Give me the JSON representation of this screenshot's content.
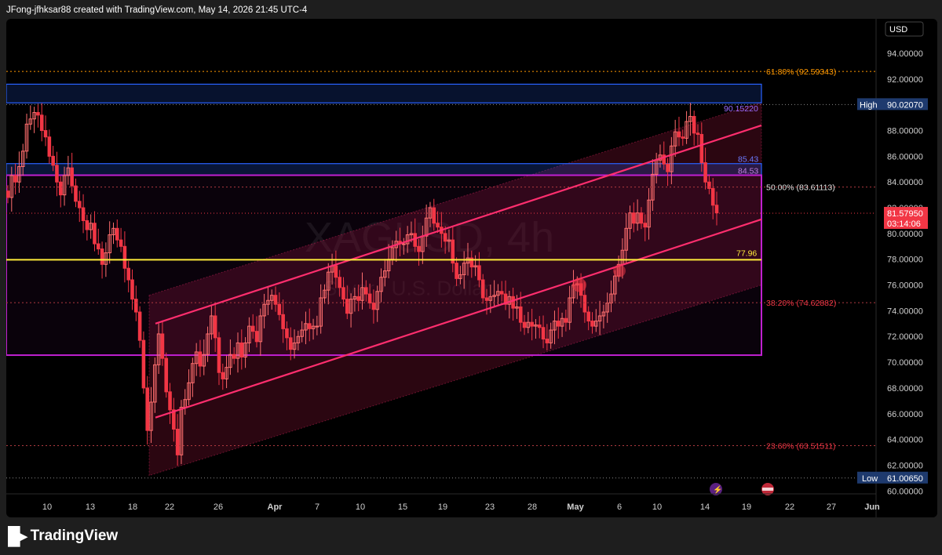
{
  "header": {
    "text": "JFong-jfhksar88 created with TradingView.com, May 14, 2026 21:45 UTC-4"
  },
  "footer": {
    "logo_icon": "tradingview-logo-icon",
    "brand": "TradingView"
  },
  "watermark": {
    "symbol": "XAGUSD, 4h",
    "description": "Silver / U.S. Dollar"
  },
  "colors": {
    "up": "#ff6e6e",
    "down": "#f23645",
    "channel": "#ff2e6e",
    "fib": "#f23645",
    "fib_top": "#ff9800",
    "demand": "#2962ff",
    "box": "#c020d0",
    "level": "#ffeb3b",
    "high_low_badge": "#1e3a6e"
  },
  "chart_data": {
    "type": "candlestick",
    "symbol": "XAGUSD",
    "timeframe": "4h",
    "currency": "USD",
    "ylim": [
      59.5,
      96.5
    ],
    "y_ticks": [
      "94.00000",
      "92.00000",
      "90.00000",
      "88.00000",
      "86.00000",
      "84.00000",
      "82.00000",
      "80.00000",
      "78.00000",
      "76.00000",
      "74.00000",
      "72.00000",
      "70.00000",
      "68.00000",
      "66.00000",
      "64.00000",
      "62.00000",
      "60.00000"
    ],
    "x_ticks": [
      "10",
      "13",
      "18",
      "22",
      "26",
      "Apr",
      "7",
      "10",
      "15",
      "19",
      "23",
      "28",
      "May",
      "6",
      "10",
      "14",
      "19",
      "22",
      "27",
      "Jun"
    ],
    "fib_levels": [
      {
        "label": "61.80% (92.59343)",
        "value": 92.59343
      },
      {
        "label": "50.00% (83.61113)",
        "value": 83.61113
      },
      {
        "label": "38.20% (74.62882)",
        "value": 74.62882
      },
      {
        "label": "23.60% (63.51511)",
        "value": 63.51511
      }
    ],
    "zone_labels": {
      "upper": "90.15220",
      "mid_top": "85.43",
      "mid_bottom": "84.53",
      "level": "77.96"
    },
    "high": {
      "label": "High",
      "value": "90.02070"
    },
    "low": {
      "label": "Low",
      "value": "61.00650"
    },
    "last_price": {
      "value": "81.57950",
      "countdown": "03:14:06"
    },
    "zones": {
      "upper_demand": [
        90.15,
        91.6
      ],
      "mid_demand": [
        84.53,
        85.43
      ],
      "box": [
        70.55,
        84.53
      ],
      "level": 77.96
    },
    "series": [
      {
        "name": "XAGUSD",
        "close": [
          82.8,
          84.5,
          84.0,
          85.2,
          86.4,
          88.5,
          88.9,
          89.4,
          89.2,
          88.0,
          87.5,
          86.0,
          85.3,
          84.0,
          83.0,
          84.5,
          85.1,
          83.7,
          82.5,
          82.0,
          81.0,
          80.3,
          80.8,
          79.2,
          78.8,
          77.6,
          78.5,
          79.9,
          80.4,
          79.5,
          79.0,
          77.3,
          76.4,
          74.9,
          73.9,
          71.7,
          68.0,
          64.7,
          66.9,
          69.8,
          72.2,
          70.3,
          67.7,
          66.3,
          64.8,
          62.8,
          66.5,
          67.1,
          68.4,
          69.9,
          70.8,
          69.7,
          70.6,
          72.2,
          73.6,
          71.9,
          69.2,
          68.7,
          69.6,
          70.6,
          70.3,
          71.5,
          70.4,
          71.5,
          72.8,
          72.4,
          71.6,
          73.6,
          74.5,
          74.8,
          75.2,
          74.5,
          73.7,
          72.6,
          71.9,
          71.0,
          71.5,
          72.0,
          72.5,
          73.0,
          72.6,
          72.8,
          72.8,
          75.0,
          75.6,
          77.0,
          77.5,
          76.6,
          75.8,
          74.9,
          73.8,
          74.9,
          75.1,
          74.8,
          75.8,
          75.3,
          74.6,
          74.1,
          75.5,
          76.6,
          77.1,
          78.0,
          78.9,
          79.4,
          79.2,
          79.2,
          79.9,
          80.0,
          79.0,
          78.6,
          79.8,
          81.2,
          82.0,
          80.8,
          80.5,
          80.0,
          79.4,
          79.5,
          77.7,
          76.5,
          76.8,
          77.7,
          78.1,
          77.4,
          77.5,
          76.4,
          75.0,
          74.8,
          75.1,
          75.2,
          75.5,
          75.3,
          74.5,
          75.1,
          74.2,
          74.3,
          73.1,
          72.7,
          73.1,
          72.8,
          72.9,
          72.7,
          71.8,
          71.5,
          72.5,
          73.2,
          72.8,
          73.4,
          73.1,
          75.0,
          76.0,
          76.1,
          75.2,
          73.9,
          73.2,
          72.8,
          73.2,
          73.6,
          73.9,
          74.6,
          75.3,
          76.7,
          77.6,
          78.7,
          80.4,
          81.6,
          80.8,
          81.6,
          80.8,
          80.5,
          82.6,
          84.6,
          85.7,
          86.1,
          85.4,
          84.8,
          86.8,
          87.9,
          87.5,
          87.4,
          88.7,
          89.1,
          87.8,
          87.7,
          85.5,
          84.0,
          83.5,
          82.2,
          81.6
        ]
      }
    ]
  }
}
